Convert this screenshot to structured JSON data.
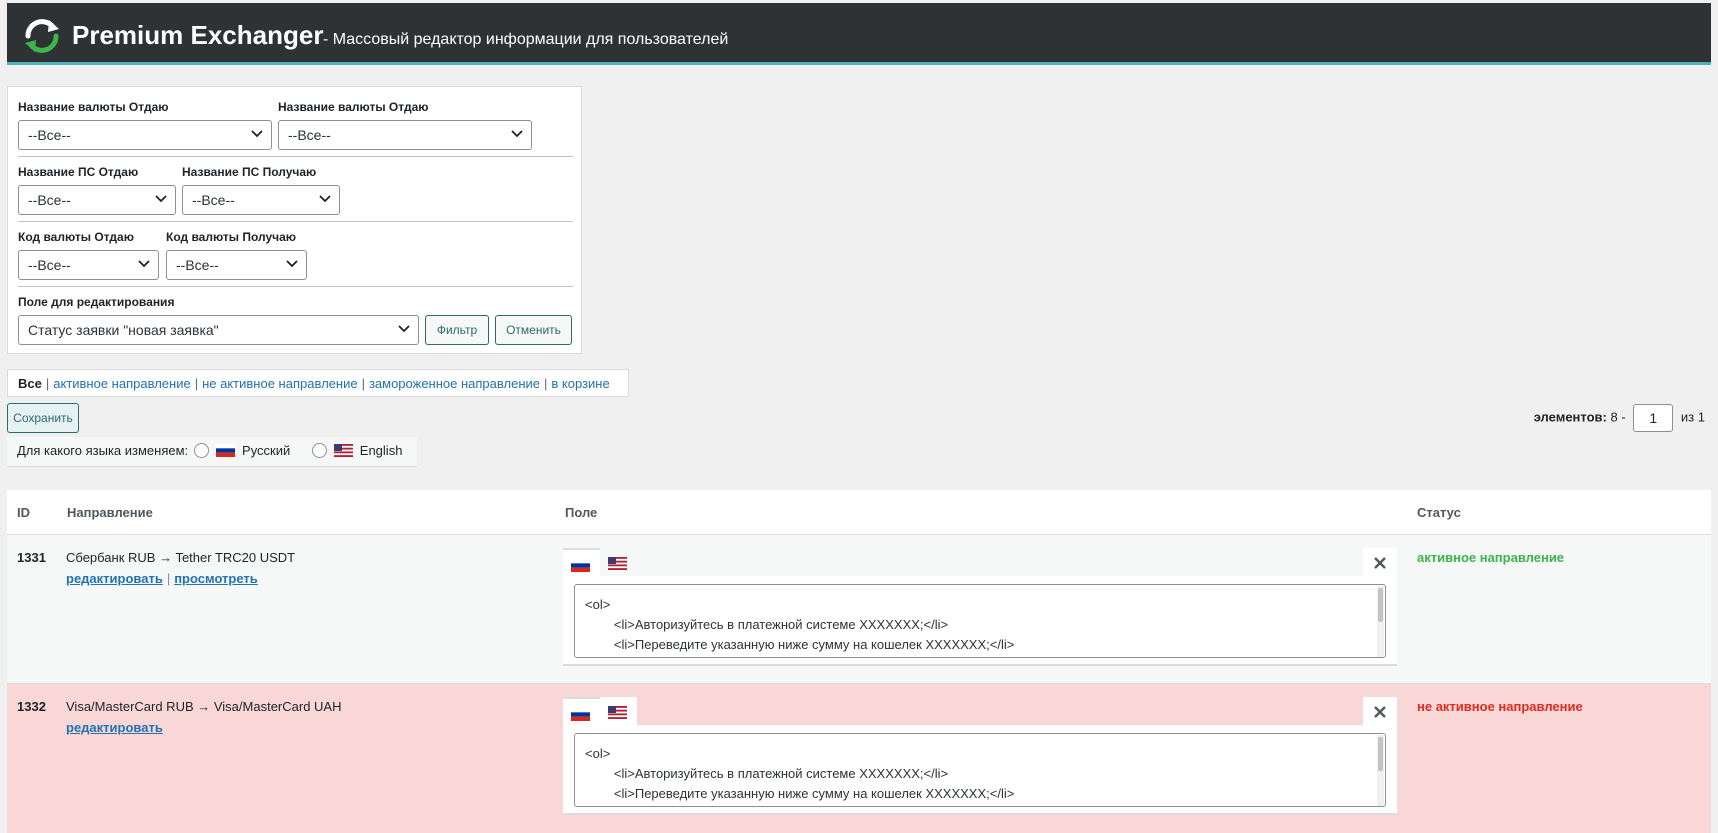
{
  "header": {
    "title": "Premium Exchanger",
    "subtitle": "- Массовый редактор информации для пользователей"
  },
  "filters": {
    "row1": [
      {
        "label": "Название валюты Отдаю",
        "value": "--Все--"
      },
      {
        "label": "Название валюты Отдаю",
        "value": "--Все--"
      }
    ],
    "row2": [
      {
        "label": "Название ПС Отдаю",
        "value": "--Все--"
      },
      {
        "label": "Название ПС Получаю",
        "value": "--Все--"
      }
    ],
    "row3": [
      {
        "label": "Код валюты Отдаю",
        "value": "--Все--"
      },
      {
        "label": "Код валюты Получаю",
        "value": "--Все--"
      }
    ],
    "edit_field": {
      "label": "Поле для редактирования",
      "value": "Статус заявки \"новая заявка\""
    },
    "filter_button": "Фильтр",
    "cancel_button": "Отменить"
  },
  "status_links": {
    "current": "Все",
    "links": [
      "активное направление",
      "не активное направление",
      "замороженное направление",
      "в корзине"
    ]
  },
  "save_button": "Сохранить",
  "language": {
    "label": "Для какого языка изменяем:",
    "options": [
      "Русский",
      "English"
    ]
  },
  "pager": {
    "label": "элементов:",
    "count": "8 -",
    "page": "1",
    "of": "из 1"
  },
  "table": {
    "columns": {
      "id": "ID",
      "direction": "Направление",
      "field": "Поле",
      "status": "Статус"
    },
    "rows": [
      {
        "id": "1331",
        "direction": "Сбербанк RUB → Tether TRC20 USDT",
        "edit_link": "редактировать",
        "view_link": "просмотреть",
        "status": "активное направление",
        "content_lines": [
          "<ol>",
          "        <li>Авторизуйтесь в платежной системе XXXXXXX;</li>",
          "        <li>Переведите указанную ниже сумму на кошелек XXXXXXX;</li>"
        ]
      },
      {
        "id": "1332",
        "direction": "Visa/MasterCard RUB → Visa/MasterCard UAH",
        "edit_link": "редактировать",
        "status": "не активное направление",
        "content_lines": [
          "<ol>",
          "        <li>Авторизуйтесь в платежной системе XXXXXXX;</li>",
          "        <li>Переведите указанную ниже сумму на кошелек XXXXXXX;</li>"
        ]
      }
    ]
  },
  "colors": {
    "active_status": "#3bb54a",
    "inactive_status": "#e02b20",
    "link": "#2271b1",
    "header_bg": "#2f3235",
    "accent": "#4fb3b7"
  },
  "icons": {
    "logo": "refresh-arrows-icon",
    "select": "chevron-down-icon",
    "ru_flag": "russia-flag-icon",
    "us_flag": "usa-flag-icon",
    "close": "close-icon"
  }
}
